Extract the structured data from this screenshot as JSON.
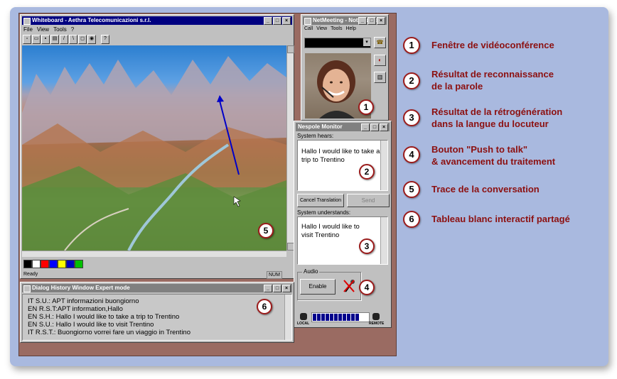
{
  "whiteboard": {
    "title": "Whiteboard - Aethra Telecomunicazioni s.r.l.",
    "menu": [
      "File",
      "View",
      "Tools",
      "?"
    ],
    "status_left": "Ready",
    "status_right": "NUM",
    "palette": [
      "#000000",
      "#ffffff",
      "#ff0000",
      "#0000ff",
      "#ffff00",
      "#0000c0",
      "#00c000"
    ]
  },
  "netmeeting": {
    "title": "NetMeeting - Not in a Call",
    "menu": [
      "Call",
      "View",
      "Tools",
      "Help"
    ]
  },
  "nespole": {
    "title": "Nespole Monitor",
    "system_hears_label": "System hears:",
    "system_hears_text": "Hallo I would like to take a trip to Trentino",
    "cancel_label": "Cancel Translation",
    "send_label": "Send",
    "system_understands_label": "System understands:",
    "system_understands_text": "Hallo I would like to visit Trentino",
    "audio_label": "Audio",
    "enable_label": "Enable",
    "local_label": "LOCAL",
    "remote_label": "REMOTE",
    "progress": 0.85
  },
  "history": {
    "title": "Dialog History Window    Expert mode",
    "lines": [
      "IT S.U.: APT informazioni buongiorno",
      "EN R.S.T:APT information,Hallo",
      "EN S.H.:  Hallo I would like to take a trip to Trentino",
      "EN S.U.:  Hallo I would like to visit Trentino",
      "IT R.S.T.: Buongiorno vorrei fare un viaggio in Trentino"
    ]
  },
  "badges": [
    "1",
    "2",
    "3",
    "4",
    "5",
    "6"
  ],
  "legend": [
    {
      "num": "1",
      "text": "Fenêtre de vidéoconférence"
    },
    {
      "num": "2",
      "text": "Résultat de reconnaissance\nde la parole"
    },
    {
      "num": "3",
      "text": "Résultat de la rétrogénération\ndans la langue du locuteur"
    },
    {
      "num": "4",
      "text": "Bouton \"Push to talk\"\n& avancement du traitement"
    },
    {
      "num": "5",
      "text": "Trace de la conversation"
    },
    {
      "num": "6",
      "text": "Tableau blanc interactif partagé"
    }
  ]
}
